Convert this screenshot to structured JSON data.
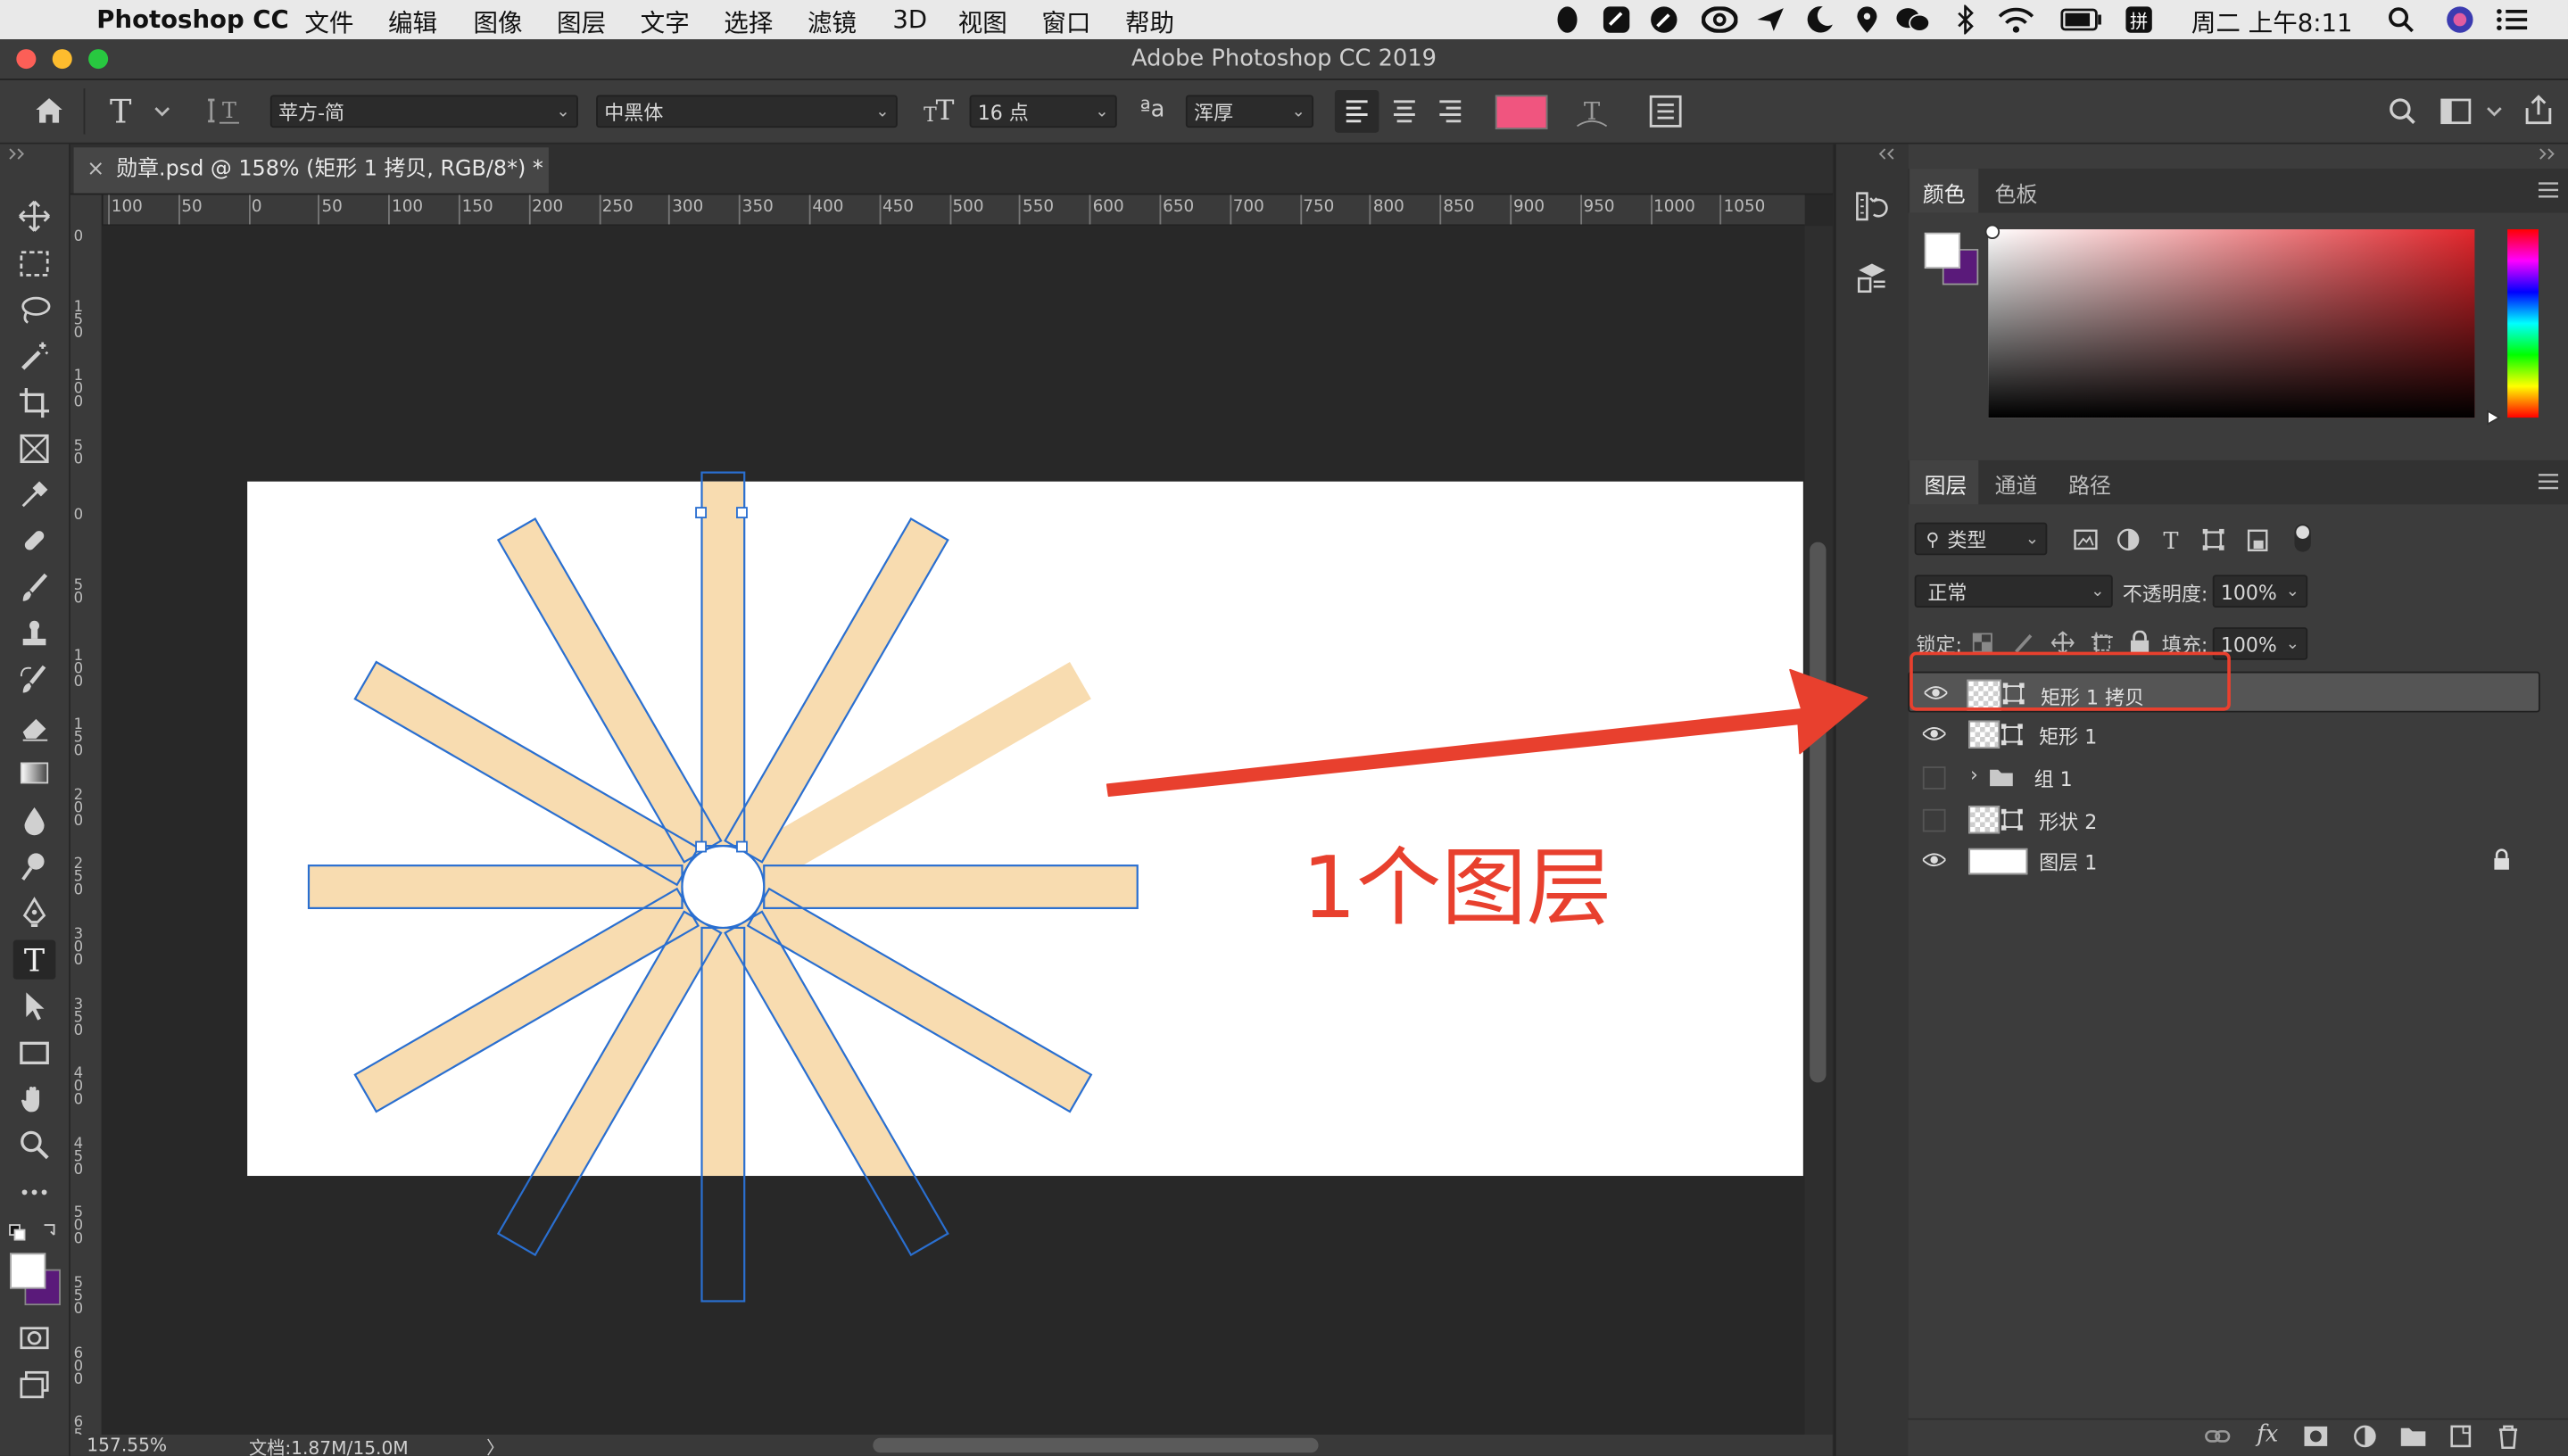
{
  "menubar": {
    "app_name": "Photoshop CC",
    "menus": [
      "文件",
      "编辑",
      "图像",
      "图层",
      "文字",
      "选择",
      "滤镜",
      "3D",
      "视图",
      "窗口",
      "帮助"
    ],
    "clock": "周二 上午8:11"
  },
  "window": {
    "title": "Adobe Photoshop CC 2019"
  },
  "options_bar": {
    "font_family": "苹方-简",
    "font_style": "中黑体",
    "font_size": "16 点",
    "aa_icon_label": "ªa",
    "antialias": "浑厚",
    "text_color": "#f0557f"
  },
  "document": {
    "tab_title": "勋章.psd @ 158% (矩形 1 拷贝, RGB/8*) *",
    "close_glyph": "×"
  },
  "rulers": {
    "horizontal": [
      "100",
      "50",
      "0",
      "50",
      "100",
      "150",
      "200",
      "250",
      "300",
      "350",
      "400",
      "450",
      "500",
      "550",
      "600",
      "650",
      "700",
      "750",
      "800",
      "850",
      "900",
      "950",
      "1000",
      "1050"
    ],
    "vertical": [
      "0",
      "150",
      "100",
      "50",
      "0",
      "50",
      "100",
      "150",
      "200",
      "250",
      "300",
      "350",
      "400",
      "450",
      "500",
      "550",
      "600",
      "650"
    ]
  },
  "status_bar": {
    "zoom": "157.55%",
    "doc_size": "文档:1.87M/15.0M",
    "arrow": "〉"
  },
  "canvas_artwork": {
    "bar_fill": "#f8dcb0",
    "outline_color": "#2a6fd0"
  },
  "annotation": {
    "text": "1个图层",
    "color": "#e8402e"
  },
  "color_panel": {
    "tabs": [
      "颜色",
      "色板"
    ],
    "foreground": "#ffffff",
    "background": "#5a1a7a",
    "hue_color": "#e2262c"
  },
  "layers_panel": {
    "tabs": [
      "图层",
      "通道",
      "路径"
    ],
    "filter_kind": "类型",
    "blend_mode": "正常",
    "opacity_label": "不透明度:",
    "opacity_value": "100%",
    "lock_label": "锁定:",
    "fill_label": "填充:",
    "fill_value": "100%",
    "layers": [
      {
        "name": "矩形 1 拷贝",
        "visible": true,
        "selected": true,
        "kind": "shape"
      },
      {
        "name": "矩形 1",
        "visible": true,
        "selected": false,
        "kind": "shape"
      },
      {
        "name": "组 1",
        "visible": false,
        "selected": false,
        "kind": "group"
      },
      {
        "name": "形状 2",
        "visible": false,
        "selected": false,
        "kind": "shape"
      },
      {
        "name": "图层 1",
        "visible": true,
        "selected": false,
        "kind": "pixel",
        "locked": true
      }
    ],
    "footer_icons": [
      "link-icon",
      "fx-icon",
      "mask-icon",
      "adjustment-icon",
      "folder-icon",
      "new-layer-icon",
      "trash-icon"
    ],
    "fx_label": "fx"
  }
}
